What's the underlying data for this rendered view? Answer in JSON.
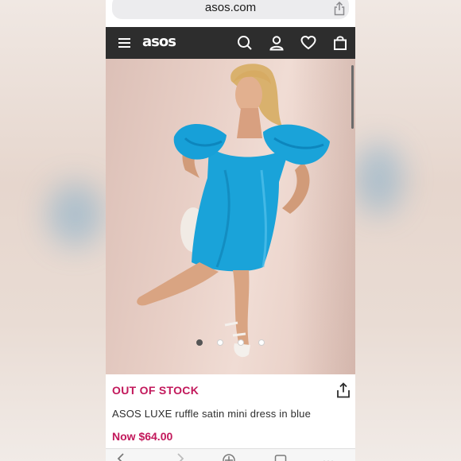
{
  "browser": {
    "url": "asos.com",
    "share_icon": "share-icon"
  },
  "header": {
    "logo": "asos",
    "bg_color": "#2d2d2d",
    "icons": [
      "menu-icon",
      "search-icon",
      "account-icon",
      "heart-icon",
      "bag-icon"
    ]
  },
  "gallery": {
    "dot_count": 4,
    "active_index": 0
  },
  "product": {
    "stock_status": "OUT OF STOCK",
    "title": "ASOS LUXE ruffle satin mini dress in blue",
    "price": "Now $64.00",
    "accent_color": "#c2185b",
    "dress_color": "#1aa3d9"
  },
  "toolbar": {
    "icons": [
      "back-icon",
      "forward-icon",
      "add-icon",
      "tabs-icon",
      "more-icon"
    ]
  }
}
